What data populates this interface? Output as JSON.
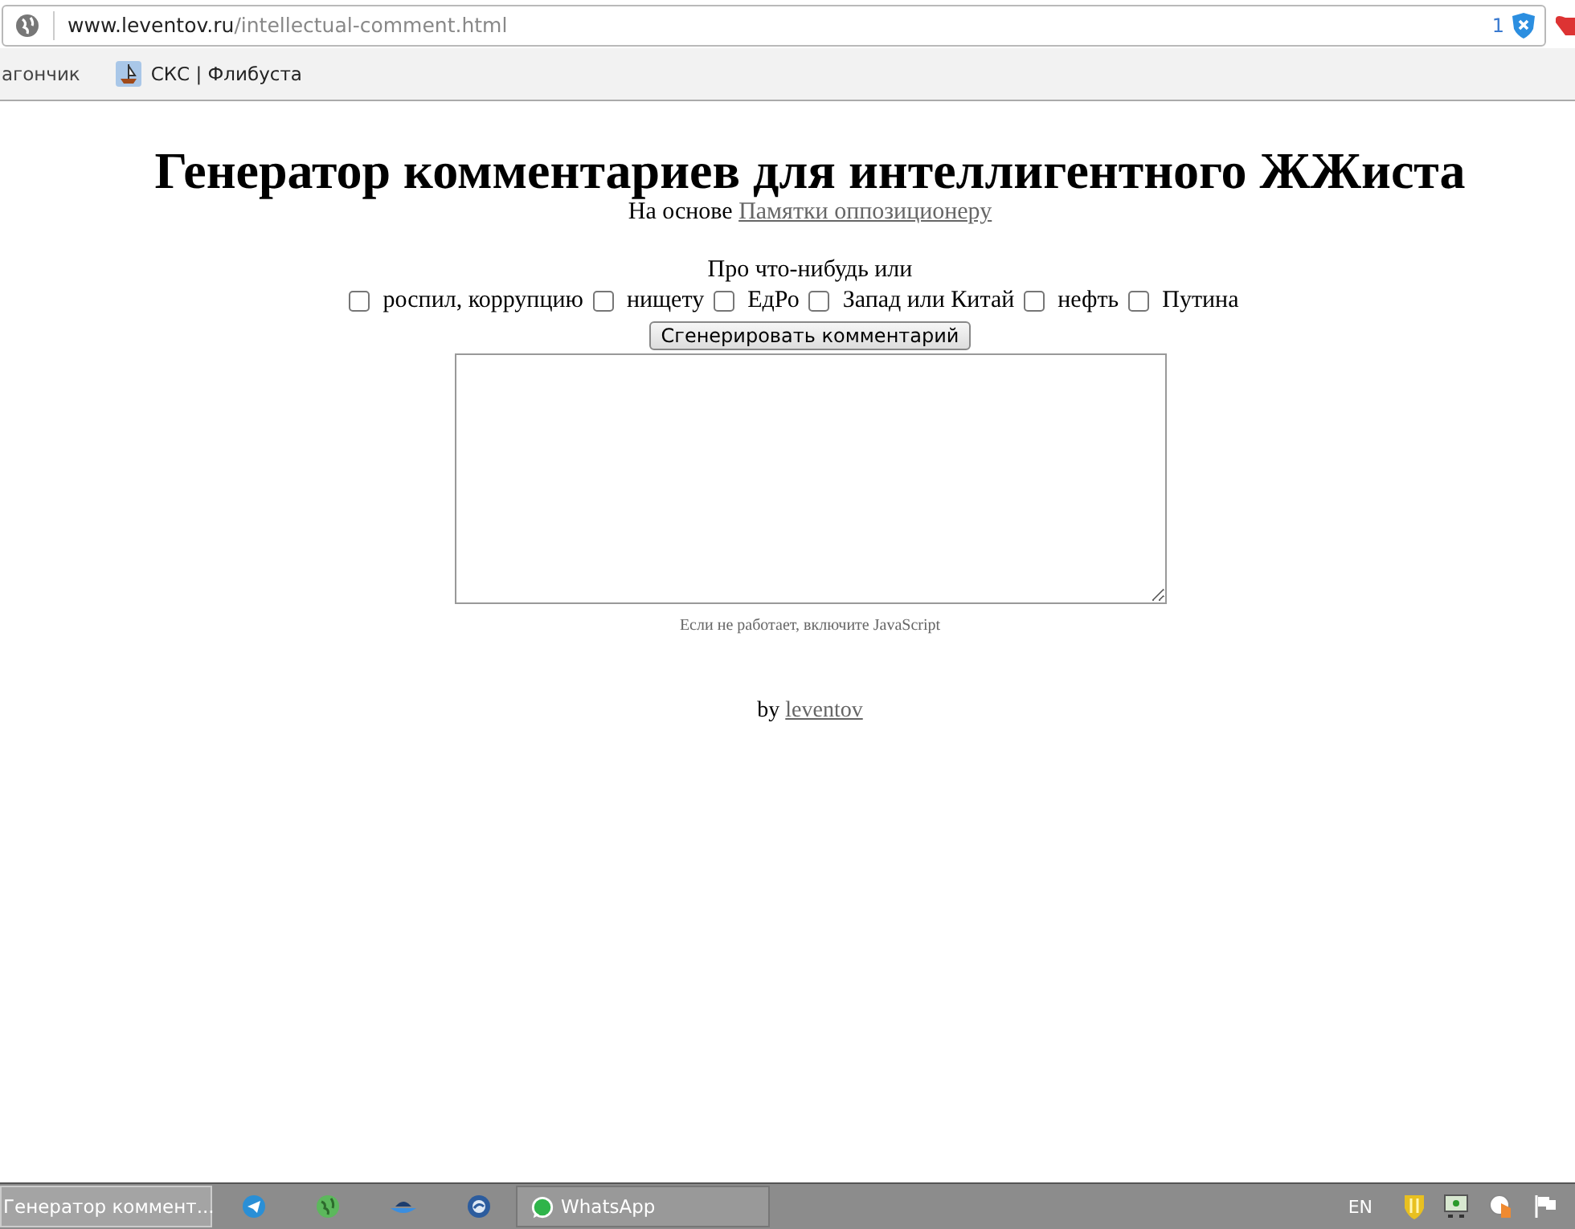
{
  "browser": {
    "url_host": "www.leventov.ru",
    "url_path": "/intellectual-comment.html",
    "blocked_count": "1",
    "bookmarks": [
      "агончик",
      "СКС | Флибуста"
    ]
  },
  "page": {
    "title": "Генератор комментариев для интеллигентного ЖЖиста",
    "subtitle_prefix": "На основе",
    "subtitle_link": "Памятки оппозиционеру",
    "topics_label": "Про что-нибудь или",
    "topics": [
      {
        "label": "роспил, коррупцию",
        "checked": false
      },
      {
        "label": "нищету",
        "checked": false
      },
      {
        "label": "ЕдРо",
        "checked": false
      },
      {
        "label": "Запад или Китай",
        "checked": false
      },
      {
        "label": "нефть",
        "checked": false
      },
      {
        "label": "Путина",
        "checked": false
      }
    ],
    "generate_button": "Сгенерировать комментарий",
    "note": "Если не работает, включите JavaScript",
    "by_prefix": "by",
    "by_link": "leventov"
  },
  "taskbar": {
    "tasks": [
      {
        "label": "Генератор коммент...",
        "selected": true
      },
      {
        "label": "WhatsApp",
        "selected": false
      }
    ],
    "language": "EN"
  }
}
